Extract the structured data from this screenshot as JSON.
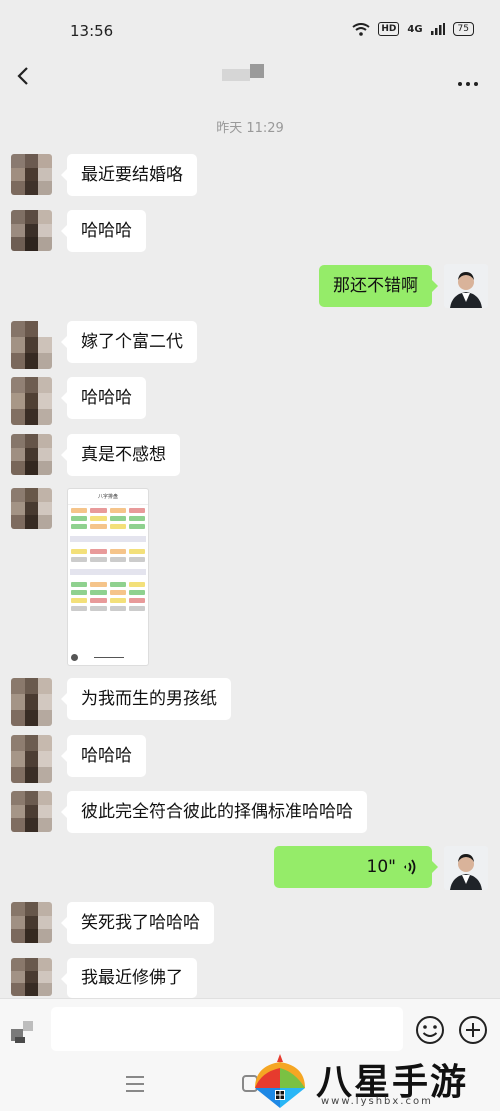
{
  "status_bar": {
    "time": "13:56",
    "hd_label": "HD",
    "signal_label": "4G",
    "battery_level": "75"
  },
  "chat": {
    "timestamp": "昨天 11:29",
    "messages": [
      {
        "side": "left",
        "type": "text",
        "text": "最近要结婚咯"
      },
      {
        "side": "left",
        "type": "text",
        "text": "哈哈哈"
      },
      {
        "side": "right",
        "type": "text",
        "text": "那还不错啊"
      },
      {
        "side": "left",
        "type": "text",
        "text": "嫁了个富二代"
      },
      {
        "side": "left",
        "type": "text",
        "text": "哈哈哈"
      },
      {
        "side": "left",
        "type": "text",
        "text": "真是不感想"
      },
      {
        "side": "left",
        "type": "image",
        "text": ""
      },
      {
        "side": "left",
        "type": "text",
        "text": "为我而生的男孩纸"
      },
      {
        "side": "left",
        "type": "text",
        "text": "哈哈哈"
      },
      {
        "side": "left",
        "type": "text",
        "text": "彼此完全符合彼此的择偶标准哈哈哈"
      },
      {
        "side": "right",
        "type": "voice",
        "text": "10\""
      },
      {
        "side": "left",
        "type": "text",
        "text": "笑死我了哈哈哈"
      },
      {
        "side": "left",
        "type": "text",
        "text": "我最近修佛了"
      }
    ]
  },
  "shared_image": {
    "header": "八字排盘"
  },
  "input_bar": {
    "placeholder": ""
  },
  "watermark": {
    "title": "八星手游网",
    "url": "www.lyshbx.com"
  },
  "icons": {
    "back": "back-chevron-icon",
    "more": "more-dots-icon",
    "voice_toggle": "voice-toggle-icon",
    "emoji": "emoji-icon",
    "plus": "plus-circle-icon",
    "voice_wave": "voice-wave-icon"
  },
  "colors": {
    "sent_bubble": "#95ec69",
    "received_bubble": "#ffffff",
    "background": "#ededed"
  }
}
